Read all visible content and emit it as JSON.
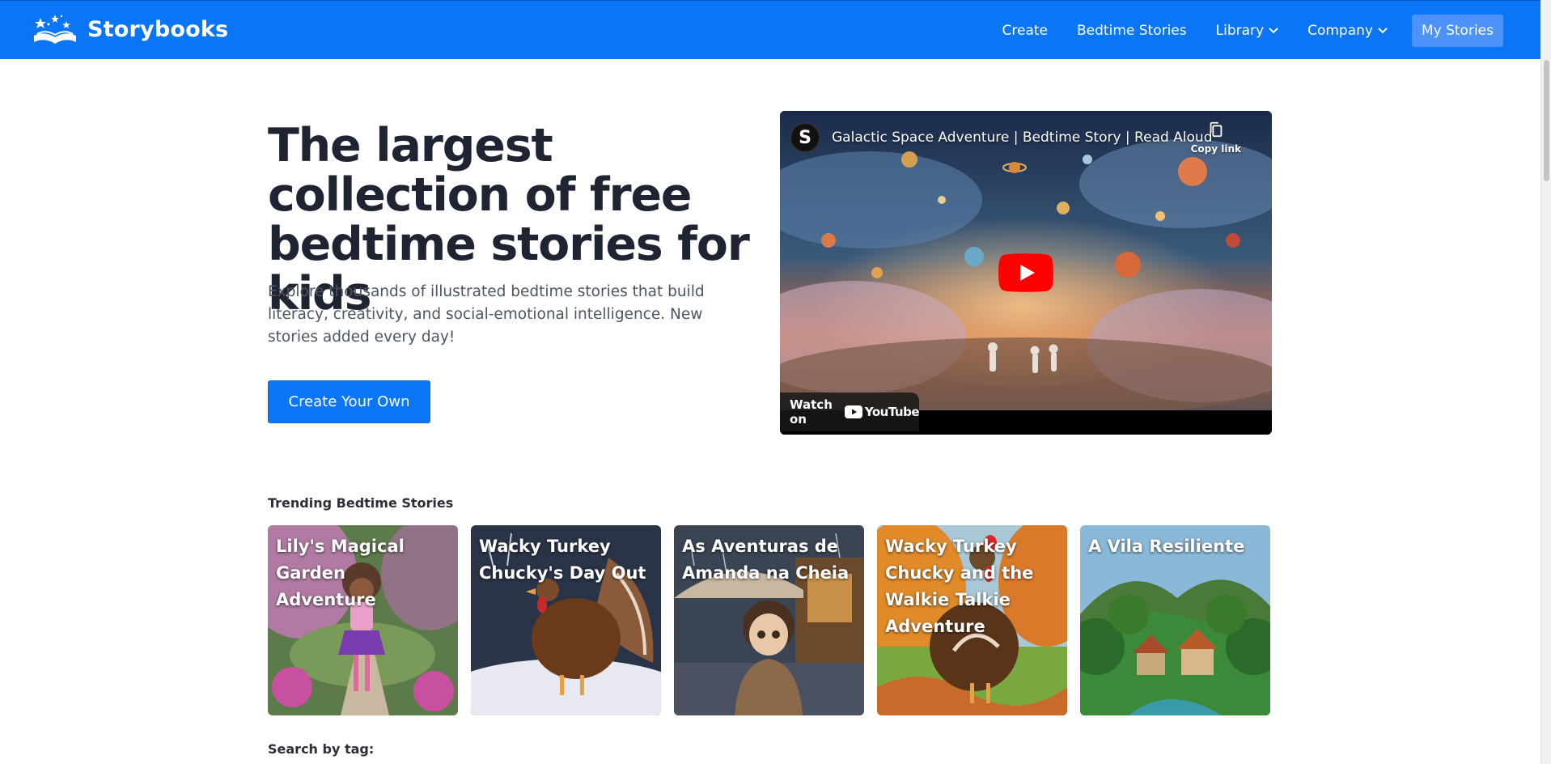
{
  "navbar": {
    "brand": "Storybooks",
    "links": [
      {
        "label": "Create",
        "dropdown": false
      },
      {
        "label": "Bedtime Stories",
        "dropdown": false
      },
      {
        "label": "Library",
        "dropdown": true
      },
      {
        "label": "Company",
        "dropdown": true
      }
    ],
    "my_stories": "My Stories"
  },
  "hero": {
    "title": "The largest collection of free bedtime stories for kids",
    "subtitle": "Explore thousands of illustrated bedtime stories that build literacy, creativity, and social-emotional intelligence. New stories added every day!",
    "cta": "Create Your Own"
  },
  "video": {
    "channel_initial": "S",
    "title": "Galactic Space Adventure | Bedtime Story | Read Aloud",
    "copy_link": "Copy link",
    "watch_on": "Watch on",
    "youtube": "YouTube"
  },
  "trending": {
    "heading": "Trending Bedtime Stories",
    "stories": [
      {
        "title": "Lily's Magical Garden Adventure"
      },
      {
        "title": "Wacky Turkey Chucky's Day Out"
      },
      {
        "title": "As Aventuras de Amanda na Cheia"
      },
      {
        "title": "Wacky Turkey Chucky and the Walkie Talkie Adventure"
      },
      {
        "title": "A Vila Resiliente"
      }
    ]
  },
  "search_by_tag": "Search by tag:",
  "colors": {
    "brand_blue": "#0a75f5",
    "my_stories_bg": "#4d92f8",
    "youtube_red": "#ff0000"
  }
}
